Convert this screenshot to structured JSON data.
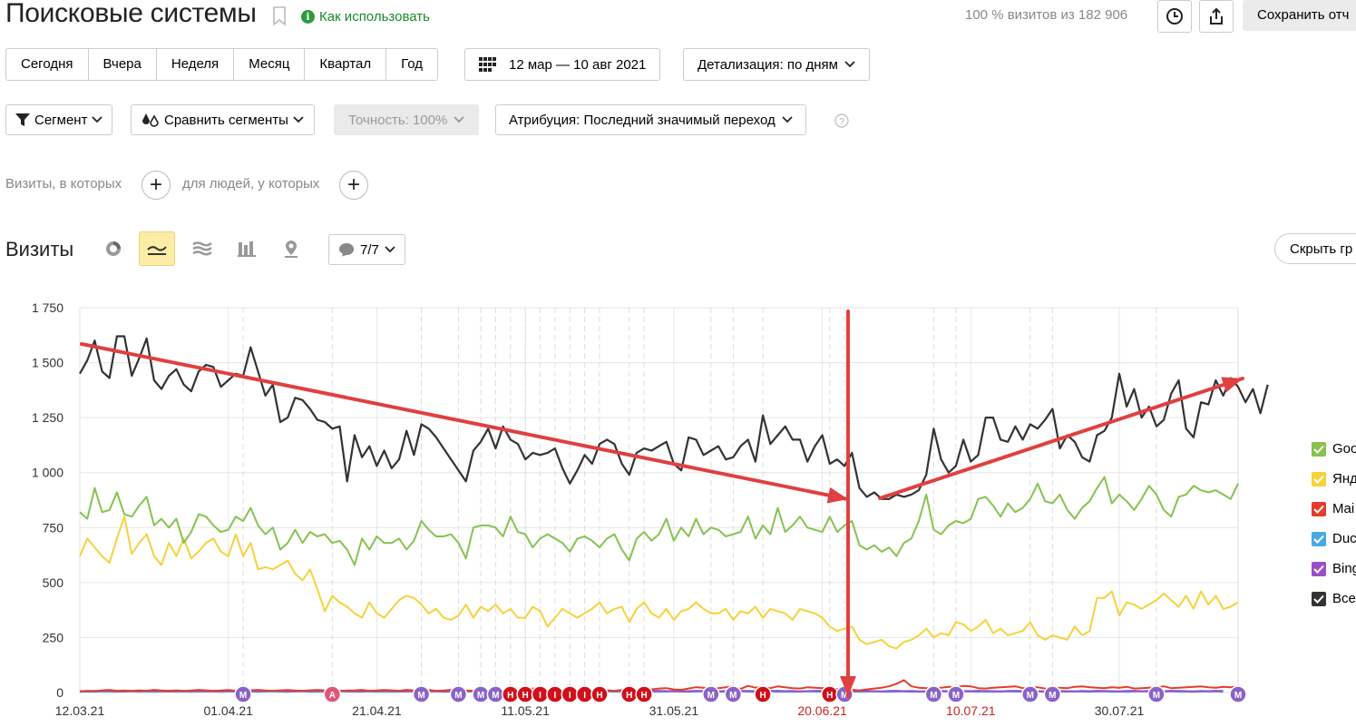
{
  "header": {
    "title": "Поисковые системы",
    "howto_label": "Как использовать",
    "visits_info": "100 % визитов из 182 906",
    "save_label": "Сохранить отч"
  },
  "period": {
    "buttons": [
      "Сегодня",
      "Вчера",
      "Неделя",
      "Месяц",
      "Квартал",
      "Год"
    ],
    "date_range": "12 мар — 10 авг 2021",
    "detail": "Детализация: по дням"
  },
  "filters": {
    "segment": "Сегмент",
    "compare": "Сравнить сегменты",
    "accuracy": "Точность: 100%",
    "attribution": "Атрибуция: Последний значимый переход"
  },
  "conditions": {
    "visits": "Визиты, в которых",
    "people": "для людей, у которых"
  },
  "chart_header": {
    "title": "Визиты",
    "notes_label": "7/7",
    "hide_label": "Скрыть гр"
  },
  "icons": [
    "bookmark-icon",
    "info-icon",
    "clock-icon",
    "share-icon",
    "calendar-icon",
    "filter-icon",
    "compare-segments-icon",
    "help-icon",
    "pie-chart-icon",
    "line-chart-icon",
    "area-chart-icon",
    "bar-chart-icon",
    "map-icon",
    "comment-icon",
    "chevron-down-icon"
  ],
  "colors": {
    "google": "#86c34f",
    "yandex": "#f6d23c",
    "mail": "#e63c2a",
    "duck": "#4aa8e8",
    "bing": "#9b4fc4",
    "total": "#333333",
    "annotation_arrow": "#e04040"
  },
  "chart_data": {
    "type": "line",
    "title": "",
    "ylim": [
      0,
      1750
    ],
    "yticks": [
      "1 750",
      "1 500",
      "1 250",
      "1 000",
      "750",
      "500",
      "250",
      "0"
    ],
    "xticks": [
      {
        "label": "12.03.21",
        "red": false
      },
      {
        "label": "01.04.21",
        "red": false
      },
      {
        "label": "21.04.21",
        "red": false
      },
      {
        "label": "11.05.21",
        "red": false
      },
      {
        "label": "31.05.21",
        "red": false
      },
      {
        "label": "20.06.21",
        "red": true
      },
      {
        "label": "10.07.21",
        "red": true
      },
      {
        "label": "30.07.21",
        "red": false
      }
    ],
    "x_start": "2021-03-12",
    "x_end": "2021-08-10",
    "series": [
      {
        "name": "Goo",
        "color": "#86c34f",
        "values": [
          820,
          790,
          930,
          820,
          830,
          910,
          810,
          800,
          850,
          890,
          760,
          790,
          750,
          790,
          680,
          730,
          810,
          800,
          760,
          730,
          740,
          800,
          780,
          840,
          760,
          720,
          750,
          650,
          680,
          740,
          680,
          730,
          710,
          720,
          680,
          690,
          650,
          580,
          700,
          650,
          710,
          680,
          680,
          700,
          650,
          690,
          780,
          740,
          710,
          710,
          720,
          680,
          610,
          750,
          760,
          760,
          750,
          710,
          800,
          730,
          720,
          660,
          700,
          720,
          700,
          680,
          640,
          700,
          710,
          690,
          660,
          700,
          720,
          650,
          600,
          700,
          730,
          690,
          720,
          790,
          690,
          750,
          710,
          790,
          720,
          750,
          740,
          710,
          720,
          730,
          800,
          700,
          760,
          720,
          840,
          730,
          760,
          800,
          750,
          740,
          730,
          800,
          730,
          760,
          780,
          670,
          650,
          670,
          640,
          660,
          620,
          680,
          700,
          780,
          900,
          740,
          720,
          760,
          780,
          770,
          790,
          880,
          890,
          850,
          800,
          860,
          820,
          840,
          880,
          950,
          870,
          860,
          900,
          830,
          790,
          840,
          870,
          930,
          980,
          860,
          900,
          870,
          830,
          880,
          940,
          900,
          830,
          800,
          890,
          900,
          940,
          920,
          910,
          920,
          900,
          880,
          950
        ]
      },
      {
        "name": "Янд",
        "color": "#f6d23c",
        "values": [
          620,
          700,
          660,
          620,
          590,
          700,
          800,
          630,
          680,
          720,
          620,
          580,
          680,
          620,
          700,
          610,
          640,
          680,
          700,
          640,
          620,
          720,
          620,
          680,
          560,
          570,
          560,
          580,
          600,
          540,
          510,
          560,
          470,
          370,
          440,
          410,
          390,
          360,
          340,
          410,
          360,
          340,
          380,
          420,
          440,
          430,
          400,
          360,
          380,
          340,
          330,
          350,
          400,
          340,
          390,
          370,
          400,
          360,
          380,
          340,
          340,
          390,
          370,
          300,
          340,
          380,
          360,
          340,
          360,
          380,
          410,
          360,
          380,
          390,
          320,
          380,
          410,
          360,
          340,
          380,
          330,
          370,
          380,
          410,
          380,
          360,
          360,
          380,
          330,
          370,
          360,
          390,
          340,
          380,
          370,
          360,
          330,
          380,
          370,
          360,
          340,
          300,
          280,
          290,
          300,
          240,
          220,
          230,
          240,
          210,
          200,
          230,
          240,
          260,
          290,
          250,
          270,
          260,
          320,
          310,
          280,
          300,
          330,
          270,
          290,
          260,
          270,
          280,
          320,
          260,
          240,
          260,
          250,
          240,
          300,
          260,
          280,
          430,
          430,
          460,
          350,
          410,
          400,
          380,
          400,
          420,
          450,
          420,
          390,
          440,
          380,
          460,
          400,
          440,
          380,
          390,
          410
        ]
      },
      {
        "name": "Mai",
        "color": "#e63c2a",
        "values": [
          5,
          8,
          6,
          10,
          12,
          8,
          9,
          7,
          10,
          8,
          12,
          9,
          8,
          10,
          7,
          9,
          12,
          10,
          8,
          9,
          11,
          8,
          7,
          10,
          12,
          9,
          8,
          10,
          11,
          9,
          8,
          10,
          12,
          9,
          11,
          8,
          9,
          10,
          12,
          8,
          9,
          11,
          10,
          8,
          12,
          9,
          10,
          11,
          8,
          9,
          12,
          10,
          9,
          8,
          11,
          10,
          12,
          9,
          8,
          10,
          12,
          18,
          15,
          10,
          9,
          12,
          11,
          8,
          10,
          9,
          12,
          10,
          8,
          11,
          9,
          12,
          10,
          14,
          18,
          20,
          14,
          12,
          18,
          24,
          22,
          18,
          20,
          24,
          28,
          16,
          30,
          22,
          26,
          20,
          28,
          24,
          20,
          18,
          24,
          22,
          20,
          18,
          16,
          14,
          12,
          10,
          14,
          18,
          22,
          28,
          40,
          56,
          28,
          22,
          20,
          18,
          22,
          26,
          24,
          30,
          28,
          20,
          18,
          22,
          24,
          26,
          28,
          20,
          22,
          24,
          18,
          16,
          22,
          20,
          26,
          28,
          24,
          22,
          20,
          24,
          22,
          26,
          18,
          20,
          22,
          24,
          28,
          20,
          22,
          24,
          26,
          28,
          24,
          22,
          26,
          24,
          28
        ]
      },
      {
        "name": "Duc",
        "color": "#4aa8e8",
        "values": [
          3,
          4,
          3,
          5,
          4,
          3,
          4,
          5,
          3,
          4,
          3,
          4,
          5,
          3,
          4,
          3,
          4,
          5,
          4,
          3,
          4,
          5,
          3,
          4,
          3,
          4,
          5,
          4,
          3,
          4,
          5,
          3,
          4,
          3,
          4,
          5,
          4,
          3,
          4,
          5,
          3,
          4,
          3,
          4,
          5,
          4,
          3,
          4,
          5,
          3,
          4,
          3,
          4,
          5,
          4,
          3,
          4,
          5,
          3,
          4,
          3,
          4,
          5,
          4,
          3,
          4,
          5,
          3,
          4,
          3,
          4,
          5,
          4,
          3,
          4,
          5,
          3,
          4,
          3,
          4,
          5,
          4,
          3,
          4,
          5,
          3,
          4,
          3,
          4,
          5,
          4,
          3,
          4,
          5,
          3,
          4,
          3,
          4,
          5,
          4,
          3,
          4,
          5,
          3,
          4,
          3,
          4,
          5,
          4,
          3,
          4,
          5,
          3,
          4,
          3,
          4,
          5,
          4,
          3,
          4,
          5,
          3,
          4,
          3,
          4,
          5,
          4,
          3,
          4,
          5,
          3,
          4,
          3,
          4,
          5,
          4,
          3,
          4,
          5,
          3,
          4,
          3,
          4,
          5,
          4,
          3,
          4,
          5,
          3,
          4,
          3,
          4,
          5,
          4,
          3
        ]
      },
      {
        "name": "Bing",
        "color": "#9b4fc4",
        "values": [
          6,
          5,
          7,
          6,
          8,
          6,
          5,
          7,
          6,
          8,
          7,
          6,
          5,
          7,
          8,
          6,
          7,
          5,
          6,
          8,
          7,
          6,
          5,
          7,
          6,
          8,
          7,
          6,
          5,
          7,
          8,
          6,
          7,
          5,
          6,
          8,
          7,
          6,
          5,
          7,
          6,
          8,
          7,
          6,
          5,
          7,
          8,
          6,
          7,
          5,
          6,
          8,
          7,
          6,
          5,
          7,
          6,
          8,
          7,
          6,
          5,
          7,
          8,
          6,
          7,
          5,
          6,
          8,
          7,
          6,
          5,
          7,
          6,
          8,
          7,
          6,
          5,
          7,
          8,
          6,
          7,
          5,
          6,
          8,
          7,
          6,
          5,
          7,
          6,
          8,
          7,
          6,
          5,
          7,
          8,
          6,
          7,
          5,
          6,
          8,
          7,
          6,
          5,
          7,
          6,
          8,
          7,
          6,
          5,
          7,
          8,
          6,
          7,
          5,
          6,
          8,
          7,
          6,
          5,
          7,
          6,
          8,
          7,
          6,
          5,
          7,
          8,
          6,
          7,
          5,
          6,
          8,
          7,
          6,
          5,
          7,
          6,
          8,
          7,
          6,
          5,
          7,
          8,
          6,
          7,
          5,
          6,
          8,
          7,
          6,
          5,
          7,
          6,
          8,
          7
        ]
      },
      {
        "name": "Все",
        "color": "#333333",
        "values": [
          1450,
          1510,
          1600,
          1460,
          1430,
          1620,
          1620,
          1440,
          1520,
          1610,
          1420,
          1380,
          1440,
          1470,
          1400,
          1370,
          1460,
          1490,
          1480,
          1390,
          1420,
          1450,
          1440,
          1570,
          1460,
          1350,
          1400,
          1230,
          1250,
          1340,
          1330,
          1290,
          1240,
          1230,
          1200,
          1210,
          960,
          1170,
          1070,
          1120,
          1030,
          1100,
          1020,
          1060,
          1190,
          1080,
          1220,
          1200,
          1160,
          1110,
          1060,
          1010,
          960,
          1100,
          1140,
          1200,
          1110,
          1210,
          1150,
          1130,
          1060,
          1090,
          1080,
          1090,
          1110,
          1020,
          950,
          1010,
          1080,
          1040,
          1130,
          1150,
          1130,
          1040,
          990,
          1090,
          1110,
          1100,
          1120,
          1140,
          1040,
          1010,
          1160,
          1150,
          1080,
          1100,
          1120,
          1060,
          1070,
          1120,
          1150,
          1050,
          1260,
          1130,
          1170,
          1210,
          1150,
          1150,
          1050,
          1120,
          1170,
          1040,
          1060,
          1030,
          1090,
          930,
          890,
          910,
          880,
          880,
          900,
          890,
          900,
          920,
          990,
          1200,
          1060,
          1000,
          1030,
          1150,
          1050,
          1080,
          1250,
          1250,
          1150,
          1140,
          1210,
          1150,
          1220,
          1200,
          1240,
          1290,
          1110,
          1170,
          1140,
          1070,
          1050,
          1170,
          1190,
          1250,
          1450,
          1300,
          1380,
          1250,
          1300,
          1210,
          1240,
          1360,
          1420,
          1200,
          1160,
          1320,
          1310,
          1420,
          1350,
          1430,
          1390,
          1320,
          1380,
          1270,
          1400
        ]
      }
    ],
    "annotations": [
      "M",
      "A",
      "M",
      "M",
      "M",
      "M",
      "H",
      "H",
      "I",
      "I",
      "I",
      "I",
      "H",
      "H",
      "H",
      "M",
      "M",
      "H",
      "H",
      "M",
      "M",
      "M",
      "M",
      "M",
      "M",
      "M"
    ]
  }
}
